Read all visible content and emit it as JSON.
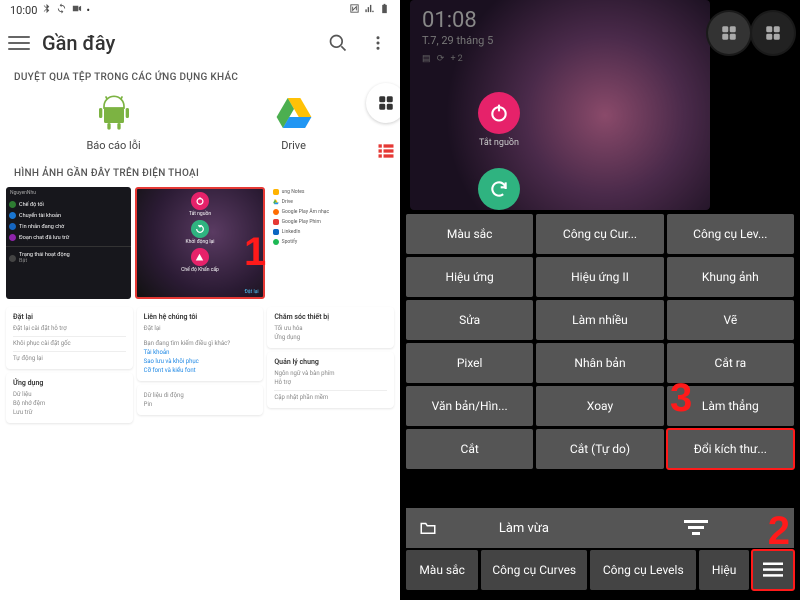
{
  "annotations": {
    "one": "1",
    "two": "2",
    "three": "3"
  },
  "left": {
    "status_time": "10:00",
    "title": "Gần đây",
    "section_browse": "DUYỆT QUA TỆP TRONG CÁC ỨNG DỤNG KHÁC",
    "apps": {
      "bug": "Báo cáo lỗi",
      "drive": "Drive"
    },
    "section_recent": "HÌNH ẢNH GẦN ĐÂY TRÊN ĐIỆN THOẠI",
    "thumb_a": {
      "header": "NguyenNhu",
      "rows": [
        "Chế độ tối",
        "Chuyển tài khoản",
        "Tin nhắn đang chờ",
        "Đoạn chat đã lưu trữ"
      ],
      "footer": "Trạng thái hoạt động",
      "footer2": "Bật"
    },
    "thumb_b": {
      "power": "Tắt nguồn",
      "restart": "Khởi động lại",
      "emerg": "Chế độ Khẩn cấp",
      "btn": "Đặt lại"
    },
    "thumb_c": {
      "rows": [
        "ung Notes",
        "Drive",
        "Google Play Âm nhạc",
        "Google Play Phim",
        "LinkedIn",
        "Spotify"
      ]
    },
    "cards": {
      "c1": {
        "h": "Đặt lại",
        "l1": "Đặt lại cài đặt hỗ trợ",
        "l2": "Khôi phục cài đặt gốc",
        "l3": "Tự động lại"
      },
      "c2": {
        "h": "Ứng dụng",
        "l1": "Dữ liệu",
        "l2": "Bộ nhớ đệm",
        "l3": "Lưu trữ"
      },
      "c3": {
        "h": "Liên hệ chúng tôi",
        "l1": "Đặt lại",
        "sub": "Bạn đang tìm kiếm điều gì khác?",
        "link1": "Tài khoản",
        "link2": "Sao lưu và khôi phục",
        "link3": "Cỡ font và kiểu font"
      },
      "c4": {
        "l1": "Dữ liệu di động",
        "l2": "Pin"
      },
      "c5": {
        "h": "Chăm sóc thiết bị",
        "l1": "Tối ưu hóa",
        "l2": "Ứng dụng"
      },
      "c6": {
        "h": "Quản lý chung",
        "l1": "Ngôn ngữ và bàn phím",
        "l2": "Hỗ trợ",
        "l3": "Cập nhật phần mềm"
      }
    }
  },
  "right": {
    "clock": "01:08",
    "date": "T.7, 29 tháng 5",
    "power_label": "Tắt nguồn",
    "grid": [
      "Màu sắc",
      "Công cụ Cur...",
      "Công cụ Lev...",
      "Hiệu ứng",
      "Hiệu ứng II",
      "Khung ảnh",
      "Sửa",
      "Làm nhiều",
      "Vẽ",
      "Pixel",
      "Nhân bản",
      "Cắt ra",
      "Văn bản/Hìn...",
      "Xoay",
      "Làm thẳng",
      "Cắt",
      "Cắt (Tự do)",
      "Đổi kích thư..."
    ],
    "toolbar2": {
      "fit": "Làm vừa"
    },
    "bottom": [
      "Màu sắc",
      "Công cụ Curves",
      "Công cụ Levels",
      "Hiệu"
    ]
  }
}
